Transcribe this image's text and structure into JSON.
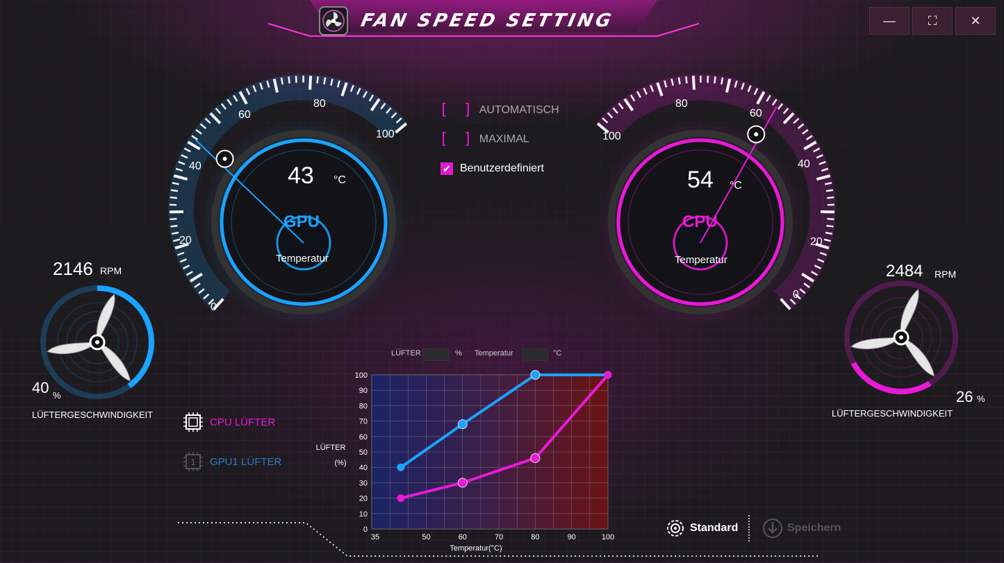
{
  "window": {
    "title": "FAN SPEED SETTING",
    "controls": {
      "minimize": "—",
      "maximize": "⛶",
      "close": "✕"
    }
  },
  "gpu_gauge": {
    "scale_labels": [
      "0",
      "20",
      "40",
      "60",
      "80",
      "100"
    ],
    "temperature": "43",
    "unit": "°C",
    "center_label": "GPU",
    "caption": "Temperatur",
    "accent": "#1aa3ff"
  },
  "cpu_gauge": {
    "scale_labels": [
      "0",
      "20",
      "40",
      "60",
      "80",
      "100"
    ],
    "temperature": "54",
    "unit": "°C",
    "center_label": "CPU",
    "caption": "Temperatur",
    "accent": "#e81ad6"
  },
  "modes": [
    {
      "label": "AUTOMATISCH",
      "checked": false
    },
    {
      "label": "MAXIMAL",
      "checked": false
    },
    {
      "label": "Benutzerdefiniert",
      "checked": true
    }
  ],
  "gpu_fan": {
    "rpm": "2146",
    "rpm_unit": "RPM",
    "percent": "40",
    "percent_unit": "%",
    "caption": "LÜFTERGESCHWINDIGKEIT",
    "level": 0.4
  },
  "cpu_fan": {
    "rpm": "2484",
    "rpm_unit": "RPM",
    "percent": "26",
    "percent_unit": "%",
    "caption": "LÜFTERGESCHWINDIGKEIT",
    "level": 0.26
  },
  "fan_tabs": {
    "cpu": "CPU LÜFTER",
    "gpu": "GPU1 LÜFTER",
    "gpu_chip_num": "1"
  },
  "chart_header": {
    "fan_label": "LÜFTER",
    "fan_unit": "%",
    "temp_label": "Temperatur",
    "temp_unit": "°C"
  },
  "buttons": {
    "standard": "Standard",
    "save": "Speichern"
  },
  "chart_data": {
    "type": "line",
    "xlabel": "Temperatur(°C)",
    "ylabel_line1": "LÜFTER",
    "ylabel_line2": "(%)",
    "xlim": [
      35,
      100
    ],
    "ylim": [
      0,
      100
    ],
    "x_ticks": [
      "35",
      "50",
      "60",
      "70",
      "80",
      "90",
      "100"
    ],
    "x_tick_values": [
      35,
      50,
      60,
      70,
      80,
      90,
      100
    ],
    "y_ticks": [
      "0",
      "10",
      "20",
      "30",
      "40",
      "50",
      "60",
      "70",
      "80",
      "90",
      "100"
    ],
    "grid": true,
    "series": [
      {
        "color": "#1aa3ff",
        "points": [
          [
            43,
            40
          ],
          [
            60,
            68
          ],
          [
            80,
            100
          ],
          [
            100,
            100
          ]
        ]
      },
      {
        "color": "#e81ad6",
        "points": [
          [
            43,
            20
          ],
          [
            60,
            30
          ],
          [
            80,
            46
          ],
          [
            100,
            100
          ]
        ]
      }
    ]
  }
}
